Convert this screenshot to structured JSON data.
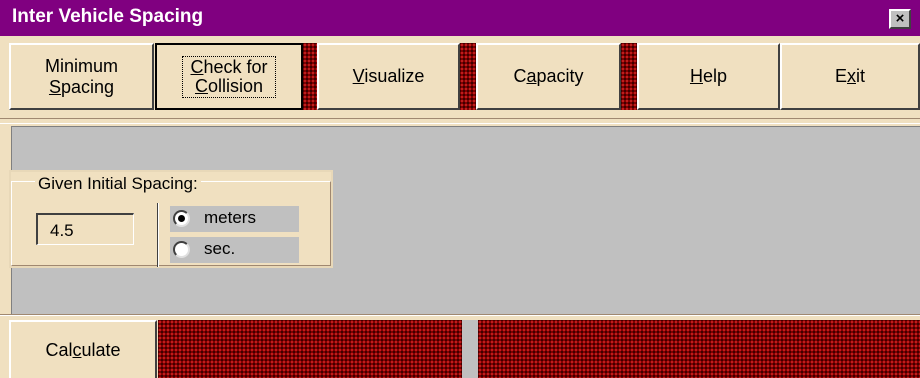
{
  "window": {
    "title": "Inter Vehicle Spacing",
    "close_label": "×"
  },
  "toolbar": {
    "minimum_spacing": {
      "line1": "Minimum",
      "line2_u": "S",
      "line2_rest": "pacing"
    },
    "check_collision": {
      "line1_u": "C",
      "line1_rest": "heck for",
      "line2_u": "C",
      "line2_rest": "ollision"
    },
    "visualize": {
      "u": "V",
      "rest": "isualize"
    },
    "capacity": {
      "pre": "C",
      "u": "a",
      "rest": "pacity"
    },
    "help": {
      "u": "H",
      "rest": "elp"
    },
    "exit": {
      "pre": "E",
      "u": "x",
      "rest": "it"
    }
  },
  "spacing_frame": {
    "legend": "Given Initial Spacing:",
    "value": "4.5",
    "options": [
      {
        "label": "meters",
        "selected": true
      },
      {
        "label": "sec.",
        "selected": false
      }
    ]
  },
  "bottom": {
    "calculate": {
      "pre": "Cal",
      "u": "c",
      "rest": "ulate"
    }
  },
  "colors": {
    "title_bar": "#800080",
    "panel": "#f0e0c0",
    "work_area": "#c0c0c0",
    "hatch": "#800000"
  }
}
